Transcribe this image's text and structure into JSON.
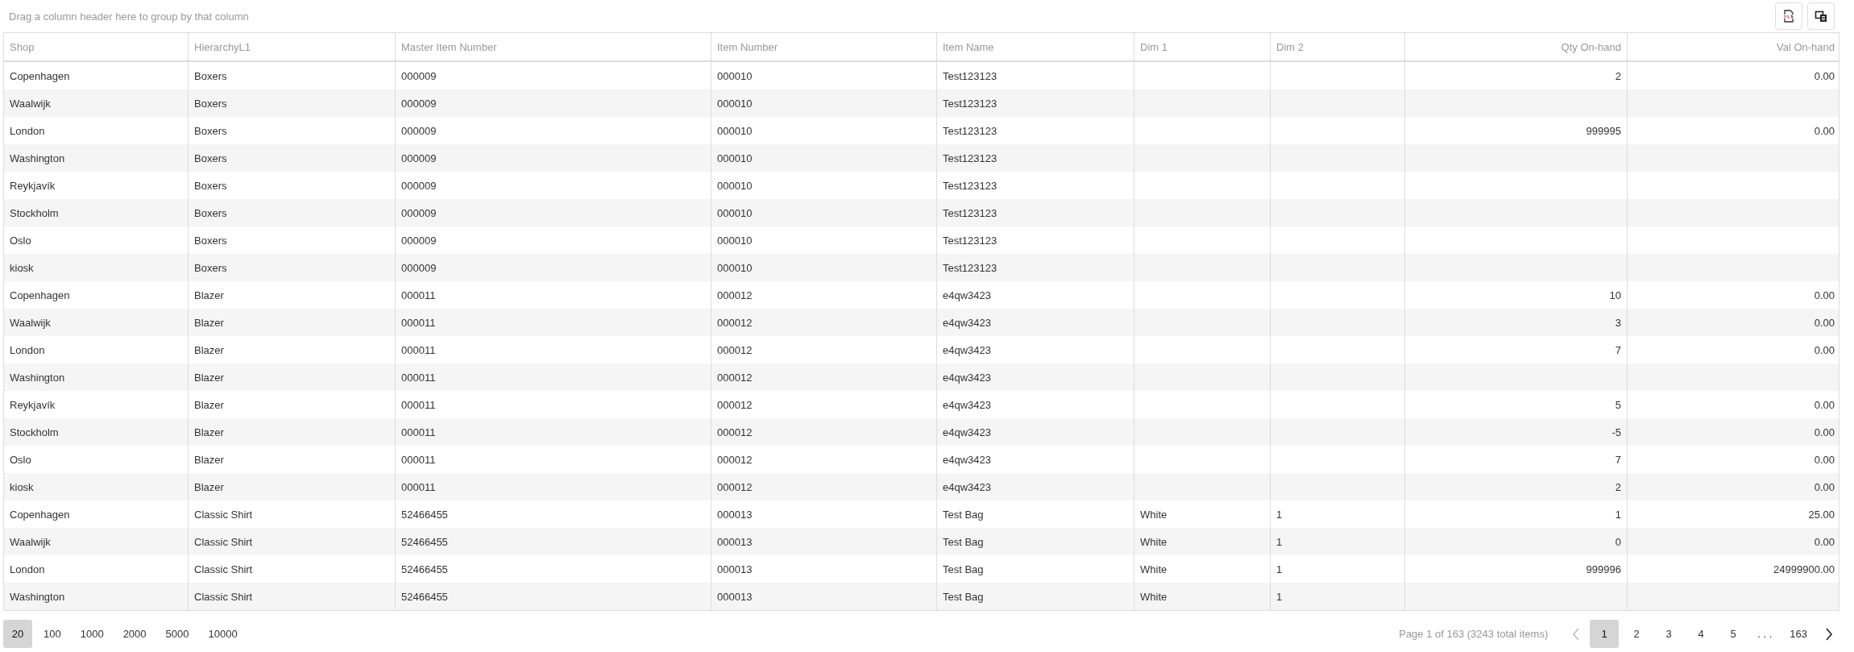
{
  "group_panel": {
    "hint": "Drag a column header here to group by that column"
  },
  "toolbar": [
    {
      "kind": "xlsx"
    },
    {
      "kind": "chooser"
    }
  ],
  "columns": [
    {
      "label": "Shop",
      "kind": "text"
    },
    {
      "label": "HierarchyL1",
      "kind": "text"
    },
    {
      "label": "Master Item Number",
      "kind": "text"
    },
    {
      "label": "Item Number",
      "kind": "text"
    },
    {
      "label": "Item Name",
      "kind": "text"
    },
    {
      "label": "Dim 1",
      "kind": "text"
    },
    {
      "label": "Dim 2",
      "kind": "text"
    },
    {
      "label": "Qty On-hand",
      "kind": "number"
    },
    {
      "label": "Val On-hand",
      "kind": "number"
    }
  ],
  "rows": [
    {
      "cells": [
        "Copenhagen",
        "Boxers",
        "000009",
        "000010",
        "Test123123",
        "",
        "",
        "2",
        "0.00"
      ]
    },
    {
      "cells": [
        "Waalwijk",
        "Boxers",
        "000009",
        "000010",
        "Test123123",
        "",
        "",
        "",
        ""
      ]
    },
    {
      "cells": [
        "London",
        "Boxers",
        "000009",
        "000010",
        "Test123123",
        "",
        "",
        "999995",
        "0.00"
      ]
    },
    {
      "cells": [
        "Washington",
        "Boxers",
        "000009",
        "000010",
        "Test123123",
        "",
        "",
        "",
        ""
      ]
    },
    {
      "cells": [
        "Reykjavík",
        "Boxers",
        "000009",
        "000010",
        "Test123123",
        "",
        "",
        "",
        ""
      ]
    },
    {
      "cells": [
        "Stockholm",
        "Boxers",
        "000009",
        "000010",
        "Test123123",
        "",
        "",
        "",
        ""
      ]
    },
    {
      "cells": [
        "Oslo",
        "Boxers",
        "000009",
        "000010",
        "Test123123",
        "",
        "",
        "",
        ""
      ]
    },
    {
      "cells": [
        "kiosk",
        "Boxers",
        "000009",
        "000010",
        "Test123123",
        "",
        "",
        "",
        ""
      ]
    },
    {
      "cells": [
        "Copenhagen",
        "Blazer",
        "000011",
        "000012",
        "e4qw3423",
        "",
        "",
        "10",
        "0.00"
      ]
    },
    {
      "cells": [
        "Waalwijk",
        "Blazer",
        "000011",
        "000012",
        "e4qw3423",
        "",
        "",
        "3",
        "0.00"
      ]
    },
    {
      "cells": [
        "London",
        "Blazer",
        "000011",
        "000012",
        "e4qw3423",
        "",
        "",
        "7",
        "0.00"
      ]
    },
    {
      "cells": [
        "Washington",
        "Blazer",
        "000011",
        "000012",
        "e4qw3423",
        "",
        "",
        "",
        ""
      ]
    },
    {
      "cells": [
        "Reykjavík",
        "Blazer",
        "000011",
        "000012",
        "e4qw3423",
        "",
        "",
        "5",
        "0.00"
      ]
    },
    {
      "cells": [
        "Stockholm",
        "Blazer",
        "000011",
        "000012",
        "e4qw3423",
        "",
        "",
        "-5",
        "0.00"
      ]
    },
    {
      "cells": [
        "Oslo",
        "Blazer",
        "000011",
        "000012",
        "e4qw3423",
        "",
        "",
        "7",
        "0.00"
      ]
    },
    {
      "cells": [
        "kiosk",
        "Blazer",
        "000011",
        "000012",
        "e4qw3423",
        "",
        "",
        "2",
        "0.00"
      ]
    },
    {
      "cells": [
        "Copenhagen",
        "Classic Shirt",
        "52466455",
        "000013",
        "Test Bag",
        "White",
        "1",
        "1",
        "25.00"
      ]
    },
    {
      "cells": [
        "Waalwijk",
        "Classic Shirt",
        "52466455",
        "000013",
        "Test Bag",
        "White",
        "1",
        "0",
        "0.00"
      ]
    },
    {
      "cells": [
        "London",
        "Classic Shirt",
        "52466455",
        "000013",
        "Test Bag",
        "White",
        "1",
        "999996",
        "24999900.00"
      ]
    },
    {
      "cells": [
        "Washington",
        "Classic Shirt",
        "52466455",
        "000013",
        "Test Bag",
        "White",
        "1",
        "",
        ""
      ]
    }
  ],
  "page_sizes": [
    {
      "label": "20",
      "selected": true
    },
    {
      "label": "100",
      "selected": false
    },
    {
      "label": "1000",
      "selected": false
    },
    {
      "label": "2000",
      "selected": false
    },
    {
      "label": "5000",
      "selected": false
    },
    {
      "label": "10000",
      "selected": false
    }
  ],
  "pager": {
    "info": "Page 1 of 163 (3243 total items)",
    "prev_disabled": true,
    "next_disabled": false,
    "pages": [
      {
        "label": "1",
        "kind": "page",
        "selected": true
      },
      {
        "label": "2",
        "kind": "page",
        "selected": false
      },
      {
        "label": "3",
        "kind": "page",
        "selected": false
      },
      {
        "label": "4",
        "kind": "page",
        "selected": false
      },
      {
        "label": "5",
        "kind": "page",
        "selected": false
      },
      {
        "label": ". . .",
        "kind": "ellipsis"
      },
      {
        "label": "163",
        "kind": "page",
        "selected": false
      }
    ]
  }
}
